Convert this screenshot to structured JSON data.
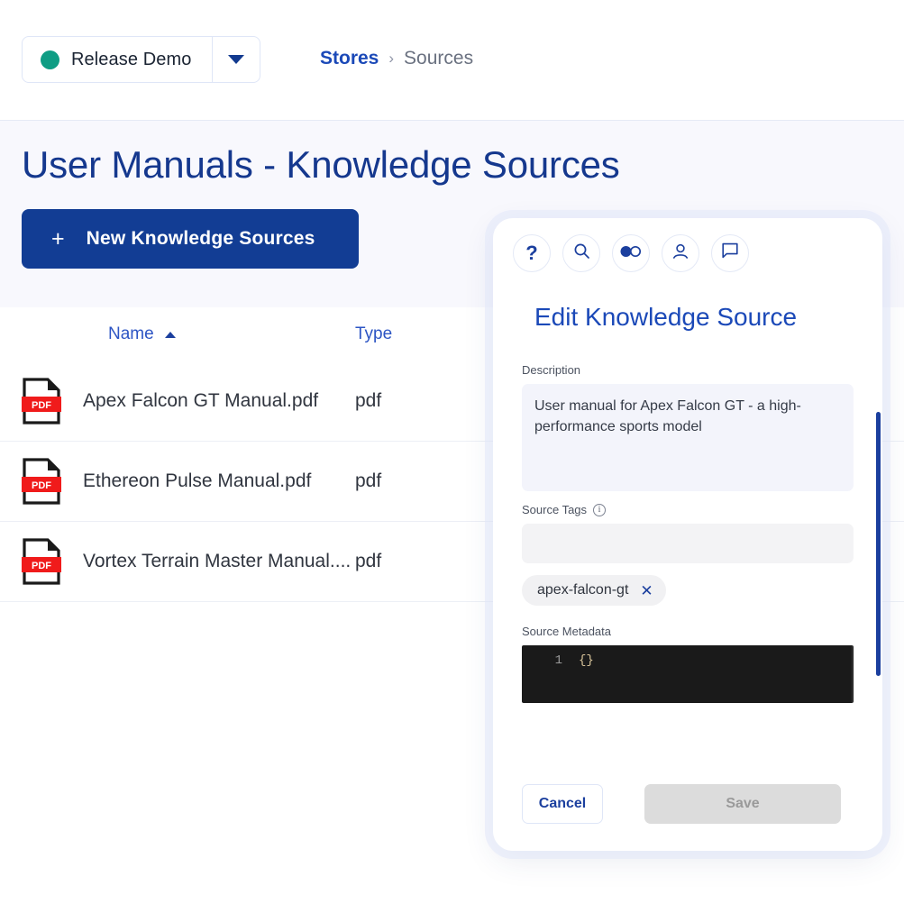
{
  "topbar": {
    "store_selector": {
      "label": "Release Demo",
      "dot_color": "#0f9d84",
      "caret_icon": "chevron-down-icon"
    },
    "breadcrumb": {
      "parent": "Stores",
      "separator": "›",
      "current": "Sources"
    }
  },
  "hero": {
    "title": "User Manuals - Knowledge Sources",
    "new_button": {
      "plus": "+",
      "label": "New Knowledge Sources"
    }
  },
  "table": {
    "columns": [
      {
        "key": "name",
        "label": "Name",
        "sorted": "asc"
      },
      {
        "key": "type",
        "label": "Type"
      }
    ],
    "rows": [
      {
        "icon": "pdf-file-icon",
        "badge": "PDF",
        "name": "Apex Falcon GT Manual.pdf",
        "type": "pdf"
      },
      {
        "icon": "pdf-file-icon",
        "badge": "PDF",
        "name": "Ethereon Pulse Manual.pdf",
        "type": "pdf"
      },
      {
        "icon": "pdf-file-icon",
        "badge": "PDF",
        "name": "Vortex Terrain Master Manual....",
        "type": "pdf"
      }
    ]
  },
  "modal": {
    "title": "Edit Knowledge Source",
    "icon_buttons": [
      {
        "name": "help-icon",
        "glyph": "?"
      },
      {
        "name": "search-icon",
        "glyph": ""
      },
      {
        "name": "toggle-icon",
        "glyph": ""
      },
      {
        "name": "user-icon",
        "glyph": ""
      },
      {
        "name": "chat-icon",
        "glyph": ""
      }
    ],
    "description": {
      "label": "Description",
      "value": "User manual for Apex Falcon GT - a high-performance sports model"
    },
    "source_tags": {
      "label": "Source Tags",
      "info_icon": "info-icon",
      "input_value": "",
      "input_placeholder": "",
      "tags": [
        {
          "label": "apex-falcon-gt",
          "remove_icon": "close-icon",
          "remove_glyph": "✕"
        }
      ]
    },
    "source_metadata": {
      "label": "Source Metadata",
      "line_number": "1",
      "value": "{}"
    },
    "footer": {
      "cancel_label": "Cancel",
      "save_label": "Save",
      "save_disabled": true
    },
    "scrollbar_color": "#1b3f9e"
  }
}
